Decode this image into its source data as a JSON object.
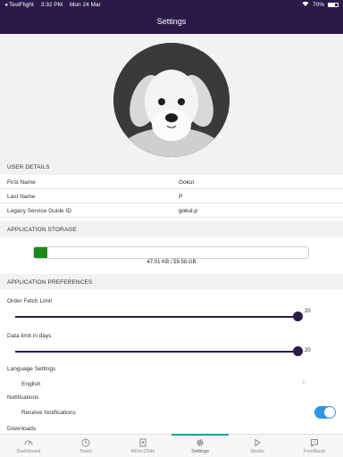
{
  "status_bar": {
    "back_app": "◂ TestFlight",
    "time": "3:32 PM",
    "date": "Mon 24 Mar",
    "battery": "70%"
  },
  "nav": {
    "title": "Settings"
  },
  "user_details": {
    "header": "USER DETAILS",
    "rows": [
      {
        "label": "First Name",
        "value": "Gokul"
      },
      {
        "label": "Last Name",
        "value": "P"
      },
      {
        "label": "Legacy Service Guide ID",
        "value": "gokul.p"
      }
    ]
  },
  "storage": {
    "header": "APPLICATION STORAGE",
    "used_fraction": 0.05,
    "text": "47.01 KB / 59.58 GB",
    "fill_color": "#1a8a1a"
  },
  "preferences": {
    "header": "APPLICATION PREFERENCES",
    "order_fetch_limit": {
      "label": "Order Fetch Limit",
      "value": "20",
      "fraction": 1.0
    },
    "data_limit_days": {
      "label": "Data limit in days",
      "value": "20",
      "fraction": 1.0
    },
    "language": {
      "label": "Language Settings",
      "value": "English"
    },
    "notifications": {
      "label": "Notifications",
      "toggle_label": "Receive Notifications",
      "enabled": true
    },
    "downloads": {
      "label": "Downloads"
    }
  },
  "tabs": [
    {
      "label": "Dashboard",
      "icon": "dashboard-icon",
      "active": false
    },
    {
      "label": "Tasks",
      "icon": "history-icon",
      "active": false
    },
    {
      "label": "MDoc2Site",
      "icon": "document-icon",
      "active": false
    },
    {
      "label": "Settings",
      "icon": "gear-icon",
      "active": true
    },
    {
      "label": "Studio",
      "icon": "play-icon",
      "active": false
    },
    {
      "label": "Feedback",
      "icon": "feedback-icon",
      "active": false
    }
  ],
  "colors": {
    "primary": "#2a1a48",
    "accent": "#16a0a0",
    "toggle": "#2f96e6"
  }
}
